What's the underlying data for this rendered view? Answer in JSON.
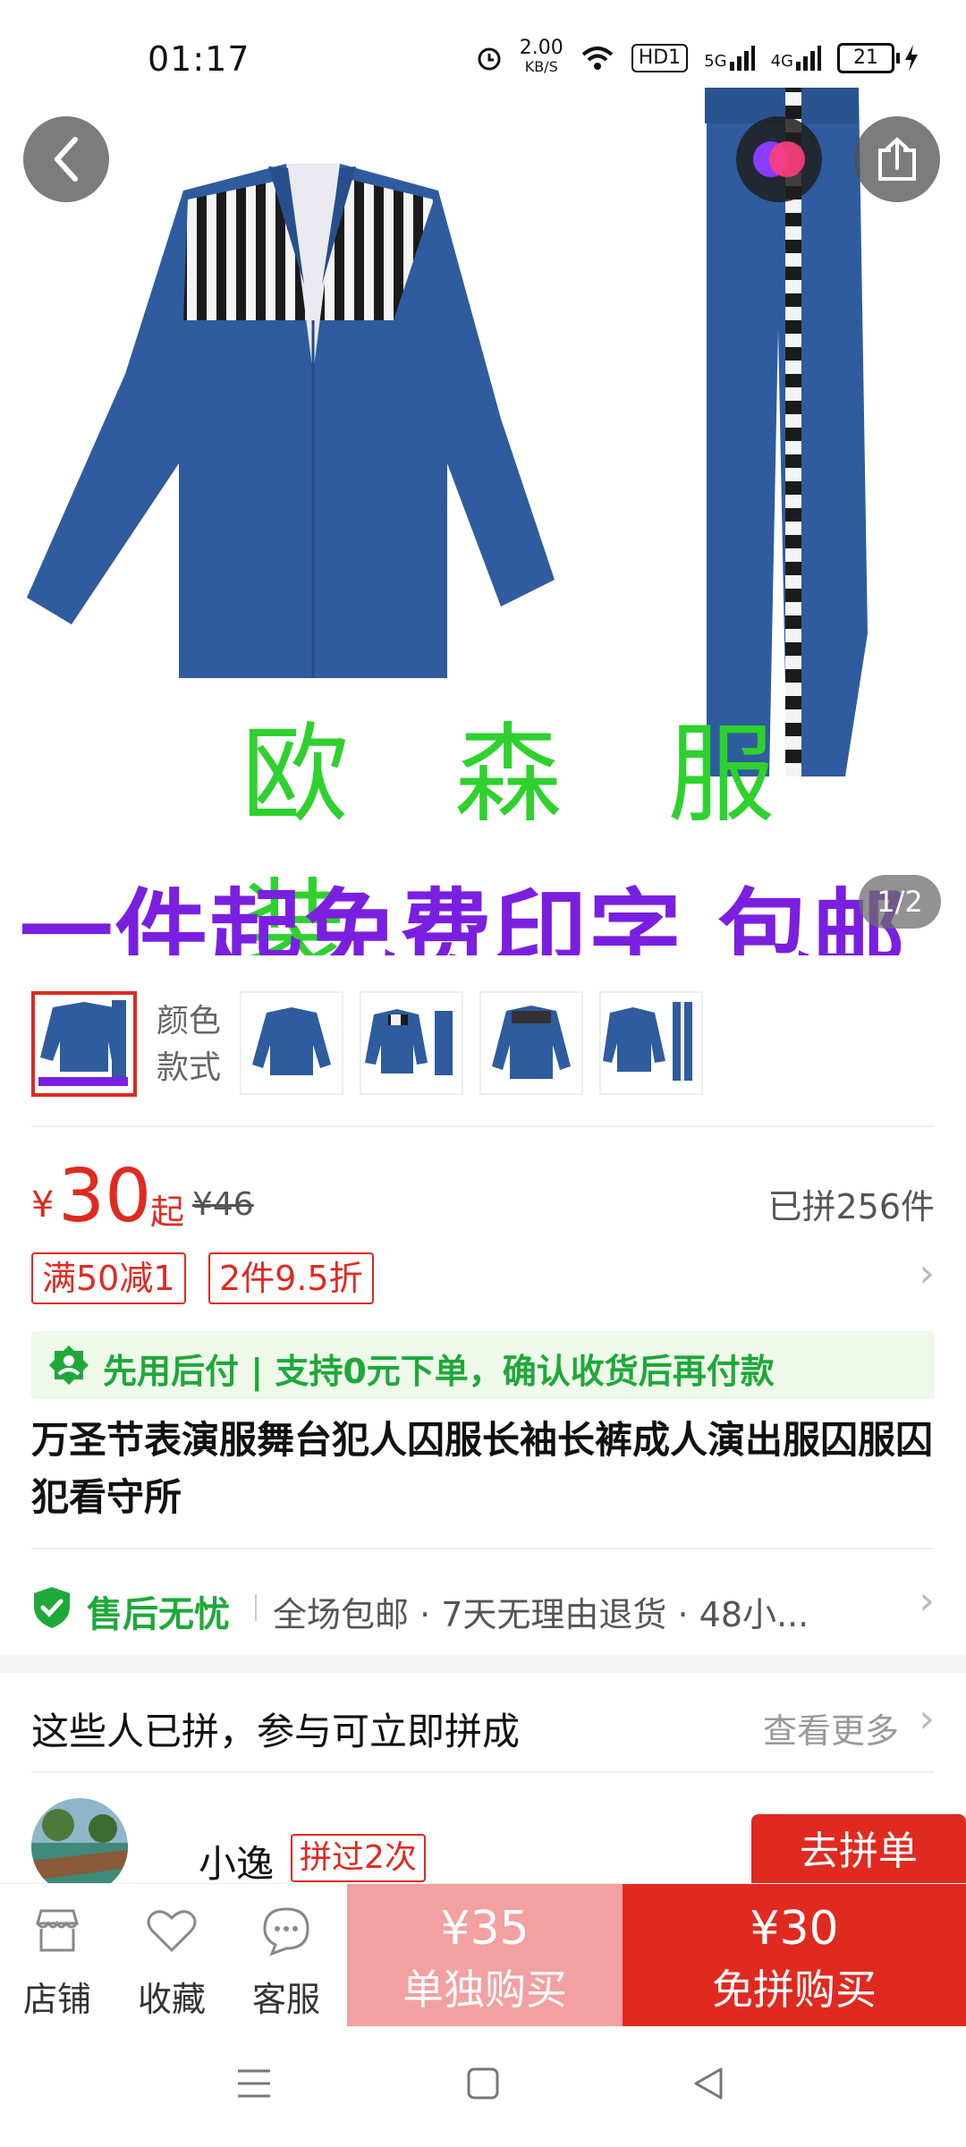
{
  "status_bar": {
    "time": "01:17",
    "net_speed": "2.00",
    "net_speed_unit": "KB/S",
    "hd_label": "HD1",
    "sig1_label": "5G",
    "sig2_label": "4G",
    "battery_level": "21"
  },
  "hero": {
    "image_counter": "1/2",
    "overlay_brand": "欧 森 服 装",
    "overlay_promo": "一件起免费印字 包邮"
  },
  "thumbnails": {
    "label_line1": "颜色",
    "label_line2": "款式",
    "count": 5
  },
  "price": {
    "currency": "¥",
    "value": "30",
    "suffix": "起",
    "original": "¥46",
    "group_sold": "已拼256件"
  },
  "coupons": [
    "满50减1",
    "2件9.5折"
  ],
  "pay_later": {
    "text": "先用后付 | 支持0元下单，确认收货后再付款"
  },
  "product_title": "万圣节表演服舞台犯人囚服长袖长裤成人演出服囚服囚犯看守所",
  "service": {
    "main": "售后无忧",
    "rest": "全场包邮 · 7天无理由退货 · 48小..."
  },
  "group_section": {
    "title": "这些人已拼，参与可立即拼成",
    "see_more": "查看更多",
    "member": {
      "name": "小逸",
      "badge": "拼过2次",
      "join_label": "去拼单"
    }
  },
  "bottom_bar": {
    "store": "店铺",
    "favorite": "收藏",
    "service": "客服",
    "single_price": "¥35",
    "single_label": "单独购买",
    "group_price": "¥30",
    "group_label": "免拼购买"
  },
  "colors": {
    "accent_red": "#e02a20",
    "pink": "#f3a0a0",
    "green": "#1fa83a",
    "promo_purple": "#7a1fe0",
    "brand_green": "#2ed12e",
    "uniform_blue": "#2f5c9e"
  }
}
